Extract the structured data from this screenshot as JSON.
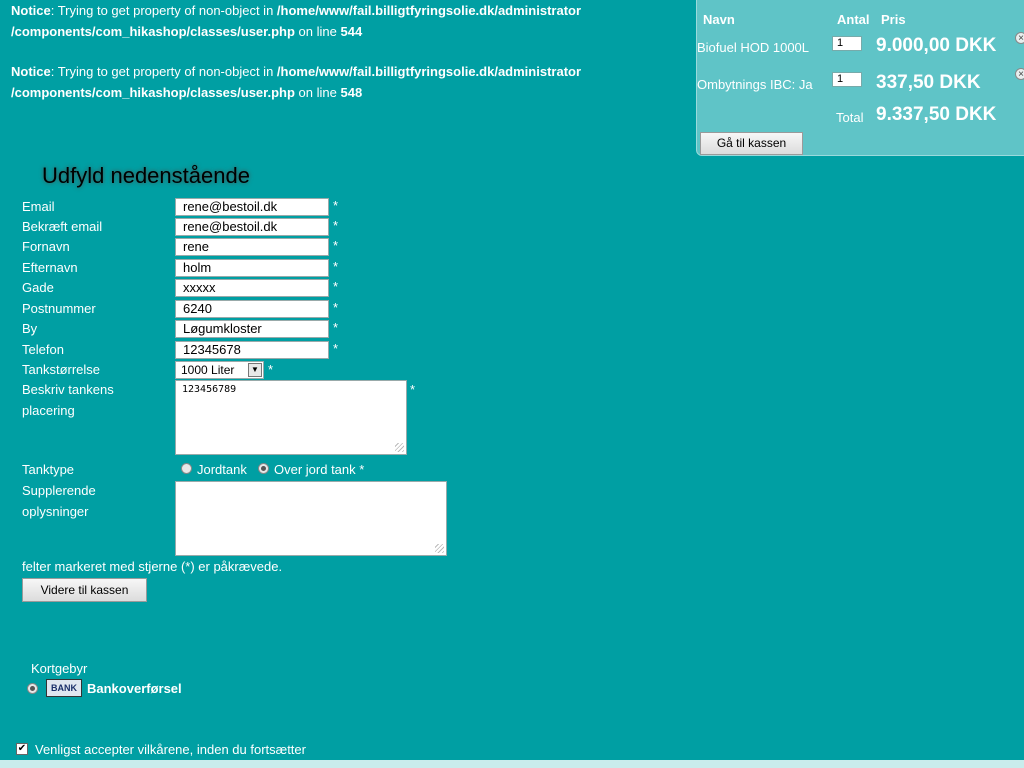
{
  "notices": [
    {
      "label": "Notice",
      "text": ": Trying to get property of non-object in ",
      "path1": "/home/www/fail.billigtfyringsolie.dk/administrator",
      "path2": "/components/com_hikashop/classes/user.php",
      "online": " on line ",
      "line": "544"
    },
    {
      "label": "Notice",
      "text": ": Trying to get property of non-object in ",
      "path1": "/home/www/fail.billigtfyringsolie.dk/administrator",
      "path2": "/components/com_hikashop/classes/user.php",
      "online": " on line ",
      "line": "548"
    }
  ],
  "cart": {
    "col_name": "Navn",
    "col_qty": "Antal",
    "col_price": "Pris",
    "items": [
      {
        "name": "Biofuel HOD 1000L",
        "qty": "1",
        "price": "9.000,00 DKK"
      },
      {
        "name": "Ombytnings IBC: Ja",
        "qty": "1",
        "price": "337,50 DKK"
      }
    ],
    "total_label": "Total",
    "total_value": "9.337,50 DKK",
    "checkout_button": "Gå til kassen"
  },
  "form": {
    "heading": "Udfyld nedenstående",
    "fields": [
      {
        "label": "Email",
        "value": "rene@bestoil.dk"
      },
      {
        "label": "Bekræft email",
        "value": "rene@bestoil.dk"
      },
      {
        "label": "Fornavn",
        "value": "rene"
      },
      {
        "label": "Efternavn",
        "value": "holm"
      },
      {
        "label": "Gade",
        "value": "xxxxx"
      },
      {
        "label": "Postnummer",
        "value": "6240"
      },
      {
        "label": "By",
        "value": "Løgumkloster"
      },
      {
        "label": "Telefon",
        "value": "12345678"
      }
    ],
    "required_mark": "*",
    "tank_size_label": "Tankstørrelse",
    "tank_size_value": "1000 Liter",
    "tank_location_label_1": "Beskriv tankens",
    "tank_location_label_2": "placering",
    "tank_location_value": "123456789",
    "tank_type_label": "Tanktype",
    "tank_type_option_1": "Jordtank",
    "tank_type_option_2": "Over jord tank *",
    "extra_label_1": "Supplerende",
    "extra_label_2": "oplysninger",
    "extra_value": "",
    "required_note": "felter markeret med stjerne (*) er påkrævede.",
    "submit_button": "Videre til kassen"
  },
  "payment": {
    "fee_label": "Kortgebyr",
    "bank_logo_text": "BANK",
    "method_label": "Bankoverførsel"
  },
  "terms": {
    "label": "Venligst accepter vilkårene, inden du fortsætter"
  }
}
